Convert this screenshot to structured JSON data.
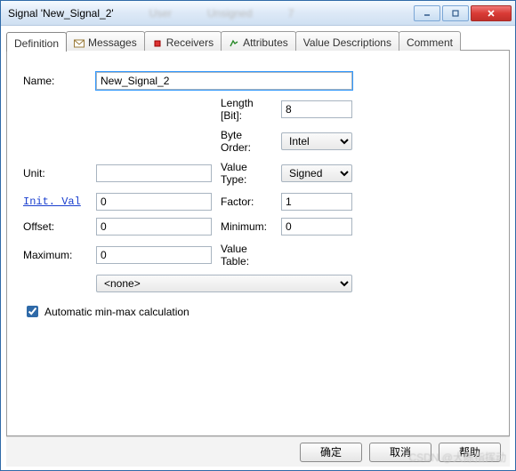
{
  "window": {
    "title": "Signal 'New_Signal_2'"
  },
  "tabs": {
    "definition": "Definition",
    "messages": "Messages",
    "receivers": "Receivers",
    "attributes": "Attributes",
    "value_descriptions": "Value Descriptions",
    "comment": "Comment"
  },
  "form": {
    "name_label": "Name:",
    "name_value": "New_Signal_2",
    "length_label": "Length [Bit]:",
    "length_value": "8",
    "byte_order_label": "Byte Order:",
    "byte_order_value": "Intel",
    "unit_label": "Unit:",
    "unit_value": "",
    "value_type_label": "Value Type:",
    "value_type_value": "Signed",
    "init_val_label": "Init. Val",
    "init_val_value": "0",
    "factor_label": "Factor:",
    "factor_value": "1",
    "offset_label": "Offset:",
    "offset_value": "0",
    "minimum_label": "Minimum:",
    "minimum_value": "0",
    "maximum_label": "Maximum:",
    "maximum_value": "0",
    "value_table_label": "Value Table:",
    "value_table_value": "<none>",
    "auto_minmax_label": "Automatic min-max calculation",
    "auto_minmax_checked": true
  },
  "buttons": {
    "ok": "确定",
    "cancel": "取消",
    "help": "帮助"
  },
  "watermark": "CSDN @大陈指挥动"
}
